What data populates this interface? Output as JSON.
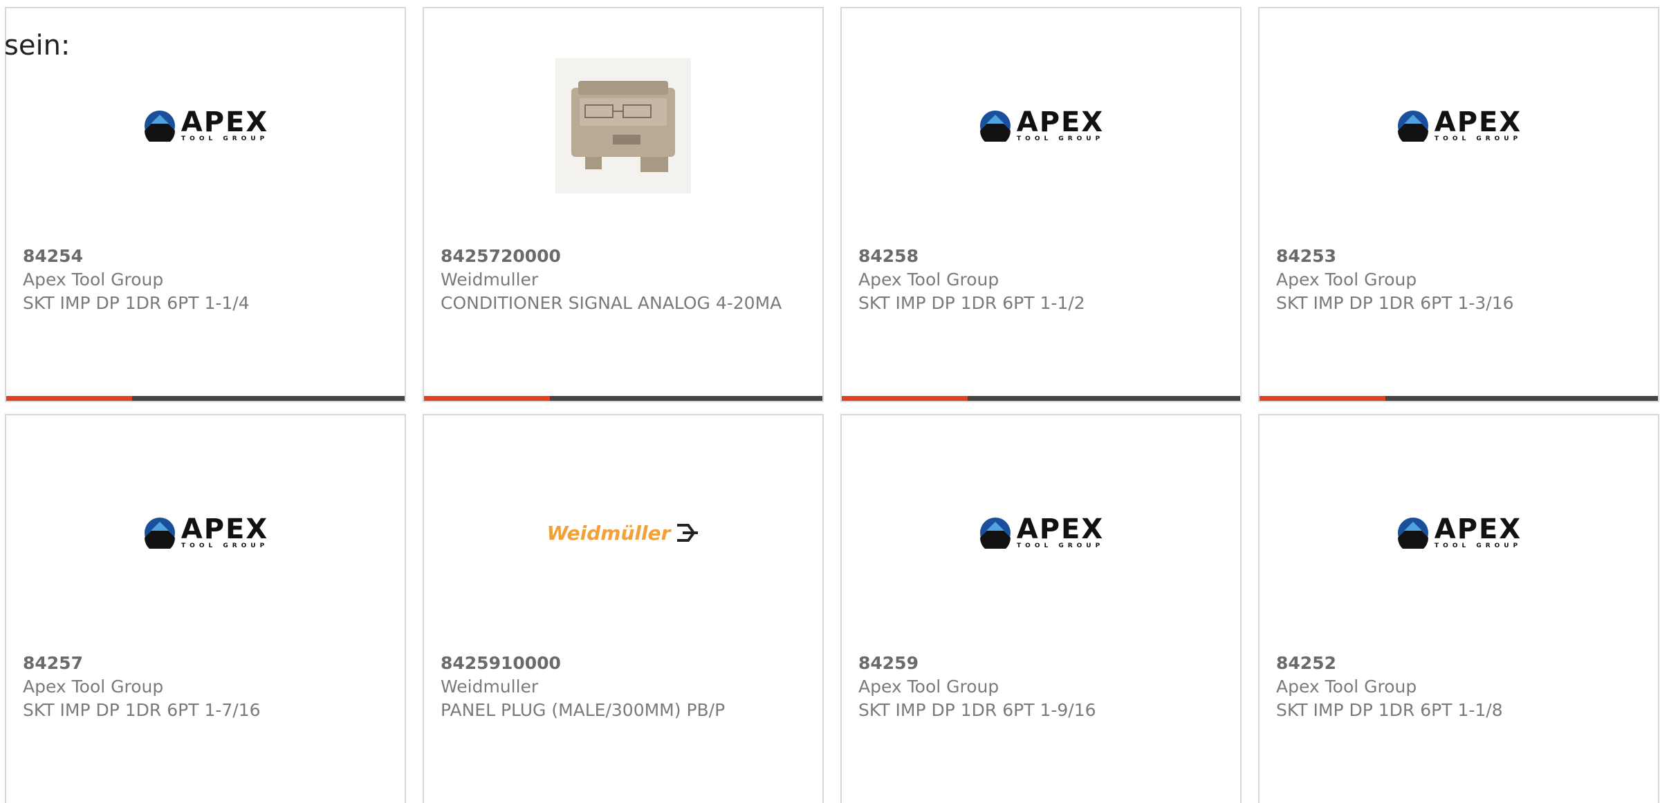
{
  "page": {
    "heading": "sein:"
  },
  "colors": {
    "accent": "#e2401c",
    "bar": "#444444",
    "border": "#d8d8d8",
    "text": "#7a7a7a",
    "weidmuller_orange": "#f0a13a"
  },
  "products": [
    {
      "part_number": "84254",
      "manufacturer": "Apex Tool Group",
      "description": "SKT IMP DP 1DR 6PT 1-1/4",
      "image": "apex-logo",
      "logo_main": "APEX",
      "logo_sub": "TOOL GROUP"
    },
    {
      "part_number": "8425720000",
      "manufacturer": "Weidmuller",
      "description": "CONDITIONER SIGNAL ANALOG 4-20MA",
      "image": "product-photo"
    },
    {
      "part_number": "84258",
      "manufacturer": "Apex Tool Group",
      "description": "SKT IMP DP 1DR 6PT 1-1/2",
      "image": "apex-logo",
      "logo_main": "APEX",
      "logo_sub": "TOOL GROUP"
    },
    {
      "part_number": "84253",
      "manufacturer": "Apex Tool Group",
      "description": "SKT IMP DP 1DR 6PT 1-3/16",
      "image": "apex-logo",
      "logo_main": "APEX",
      "logo_sub": "TOOL GROUP"
    },
    {
      "part_number": "84257",
      "manufacturer": "Apex Tool Group",
      "description": "SKT IMP DP 1DR 6PT 1-7/16",
      "image": "apex-logo",
      "logo_main": "APEX",
      "logo_sub": "TOOL GROUP"
    },
    {
      "part_number": "8425910000",
      "manufacturer": "Weidmuller",
      "description": "PANEL PLUG (MALE/300MM) PB/P",
      "image": "weidmuller-logo",
      "logo_main": "Weidmüller"
    },
    {
      "part_number": "84259",
      "manufacturer": "Apex Tool Group",
      "description": "SKT IMP DP 1DR 6PT 1-9/16",
      "image": "apex-logo",
      "logo_main": "APEX",
      "logo_sub": "TOOL GROUP"
    },
    {
      "part_number": "84252",
      "manufacturer": "Apex Tool Group",
      "description": "SKT IMP DP 1DR 6PT 1-1/8",
      "image": "apex-logo",
      "logo_main": "APEX",
      "logo_sub": "TOOL GROUP"
    }
  ]
}
